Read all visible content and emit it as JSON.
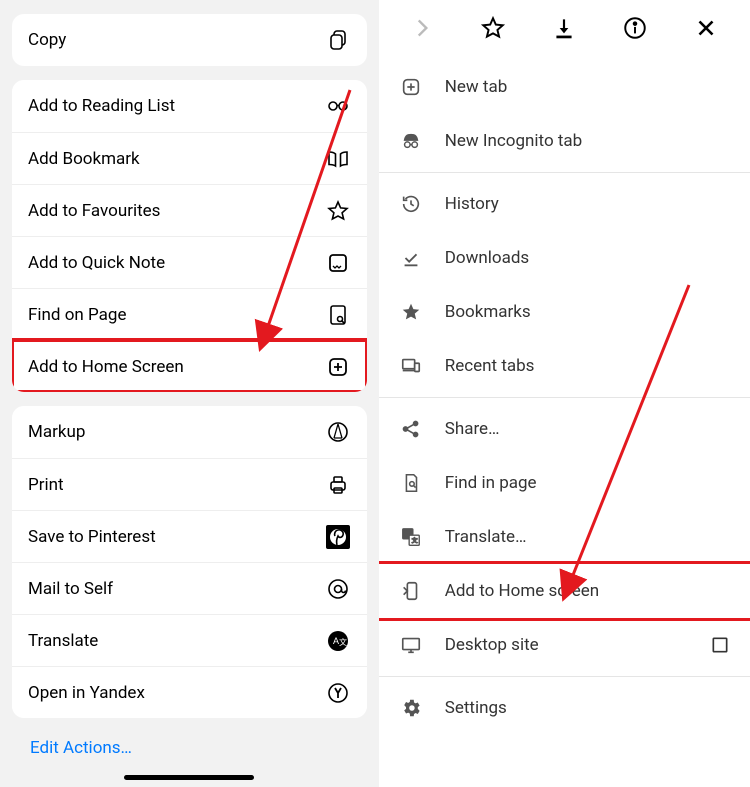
{
  "ios": {
    "copy": "Copy",
    "addReadingList": "Add to Reading List",
    "addBookmark": "Add Bookmark",
    "addFavourites": "Add to Favourites",
    "addQuickNote": "Add to Quick Note",
    "findOnPage": "Find on Page",
    "addHomeScreen": "Add to Home Screen",
    "markup": "Markup",
    "print": "Print",
    "savePinterest": "Save to Pinterest",
    "mailSelf": "Mail to Self",
    "translate": "Translate",
    "openYandex": "Open in Yandex",
    "editActions": "Edit Actions…"
  },
  "chrome": {
    "newTab": "New tab",
    "incognito": "New Incognito tab",
    "history": "History",
    "downloads": "Downloads",
    "bookmarks": "Bookmarks",
    "recentTabs": "Recent tabs",
    "share": "Share…",
    "findInPage": "Find in page",
    "translate": "Translate…",
    "addHomeScreen": "Add to Home screen",
    "desktopSite": "Desktop site",
    "settings": "Settings"
  },
  "highlightColor": "#e3191f"
}
